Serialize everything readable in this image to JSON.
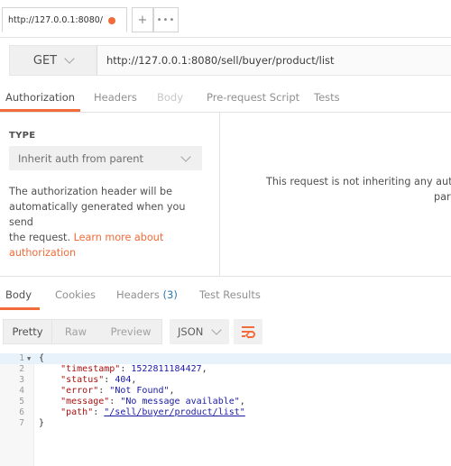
{
  "tabstrip": {
    "active_tab_label": "http://127.0.0.1:8080/",
    "add_tab_label": "+",
    "more_tabs_label": "•••"
  },
  "request": {
    "method": "GET",
    "url": "http://127.0.0.1:8080/sell/buyer/product/list"
  },
  "request_tabs": {
    "authorization": "Authorization",
    "headers": "Headers",
    "body": "Body",
    "prerequest": "Pre-request Script",
    "tests": "Tests"
  },
  "auth": {
    "type_label": "TYPE",
    "type_value": "Inherit auth from parent",
    "desc_line1": "The authorization header will be",
    "desc_line2": "automatically generated when you send",
    "desc_line3_text": "the request. ",
    "desc_link1": "Learn more about",
    "desc_link2": "authorization",
    "right_line1": "This request is not inheriting any author",
    "right_line2": "pare"
  },
  "response_tabs": {
    "body": "Body",
    "cookies": "Cookies",
    "headers": "Headers",
    "headers_count": "(3)",
    "test_results": "Test Results"
  },
  "response_toolbar": {
    "pretty": "Pretty",
    "raw": "Raw",
    "preview": "Preview",
    "format": "JSON"
  },
  "response_body": {
    "line_numbers": [
      "1",
      "2",
      "3",
      "4",
      "5",
      "6",
      "7"
    ],
    "open_brace": "{",
    "close_brace": "}",
    "timestamp_key": "\"timestamp\"",
    "timestamp_val": "1522811184427",
    "status_key": "\"status\"",
    "status_val": "404",
    "error_key": "\"error\"",
    "error_val": "\"Not Found\"",
    "message_key": "\"message\"",
    "message_val": "\"No message available\"",
    "path_key": "\"path\"",
    "path_val": "\"/sell/buyer/product/list\""
  },
  "colors": {
    "accent": "#f26b3a",
    "link": "#2a7ab0"
  }
}
